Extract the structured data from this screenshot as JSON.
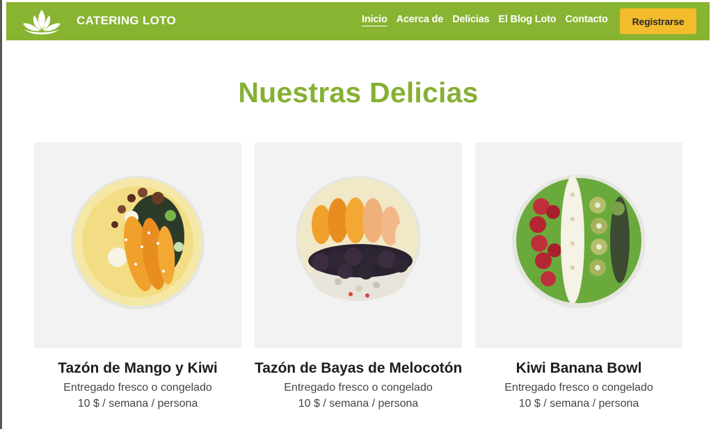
{
  "brand": {
    "name": "CATERING LOTO",
    "logo_icon": "lotus-icon"
  },
  "nav": {
    "links": [
      {
        "label": "Inicio",
        "active": true
      },
      {
        "label": "Acerca de"
      },
      {
        "label": "Delicias"
      },
      {
        "label": "El Blog Loto"
      },
      {
        "label": "Contacto"
      }
    ],
    "signup_label": "Registrarse"
  },
  "colors": {
    "accent": "#88b431",
    "button": "#f2bc2c",
    "title": "#86b034"
  },
  "main": {
    "title": "Nuestras Delicias",
    "cards": [
      {
        "title": "Tazón de Mango y Kiwi",
        "delivery": "Entregado fresco o congelado",
        "price": "10 $ / semana / persona",
        "image_icon": "mango-kiwi-bowl-image"
      },
      {
        "title": "Tazón de Bayas de Melocotón",
        "delivery": "Entregado fresco o congelado",
        "price": "10 $ / semana / persona",
        "image_icon": "peach-berry-bowl-image"
      },
      {
        "title": "Kiwi Banana Bowl",
        "delivery": "Entregado fresco o congelado",
        "price": "10 $ / semana / persona",
        "image_icon": "kiwi-banana-bowl-image"
      }
    ]
  }
}
